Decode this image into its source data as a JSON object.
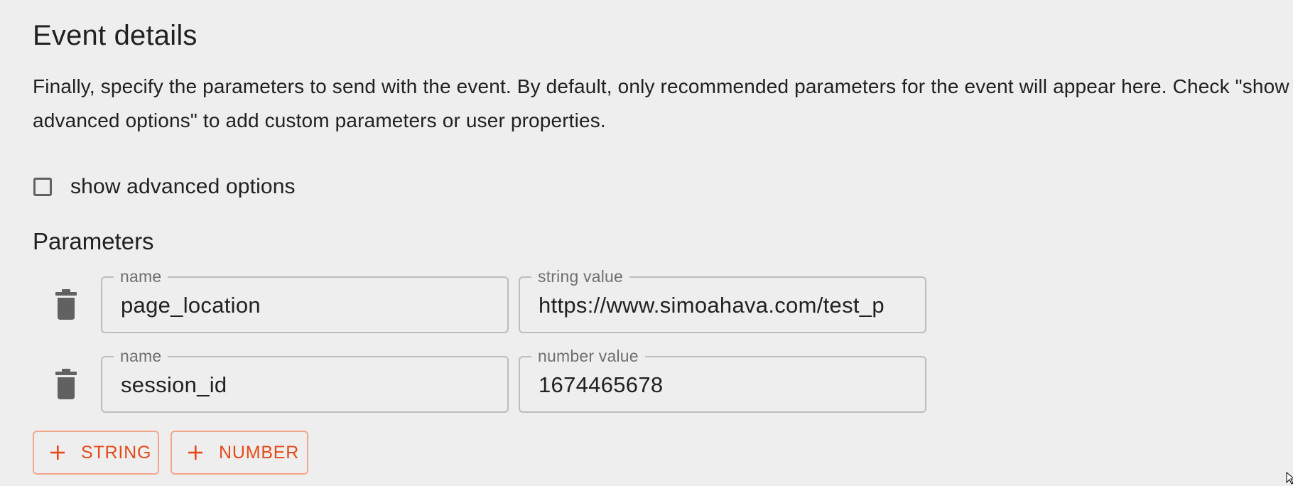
{
  "section": {
    "title": "Event details",
    "description": "Finally, specify the parameters to send with the event. By default, only recommended parameters for the event will appear here. Check \"show advanced options\" to add custom parameters or user properties."
  },
  "advanced_options": {
    "label": "show advanced options",
    "checked": false
  },
  "parameters": {
    "heading": "Parameters",
    "rows": [
      {
        "name_label": "name",
        "name_value": "page_location",
        "value_label": "string value",
        "value_value": "https://www.simoahava.com/test_p",
        "delete_icon": "trash-icon"
      },
      {
        "name_label": "name",
        "name_value": "session_id",
        "value_label": "number value",
        "value_value": "1674465678",
        "delete_icon": "trash-icon"
      }
    ],
    "add_string_label": "STRING",
    "add_number_label": "NUMBER"
  },
  "colors": {
    "background": "#eeeeee",
    "accent": "#e64a19",
    "accent_border": "#f4a58a",
    "field_border": "#bdbdbd",
    "icon_gray": "#616161"
  }
}
